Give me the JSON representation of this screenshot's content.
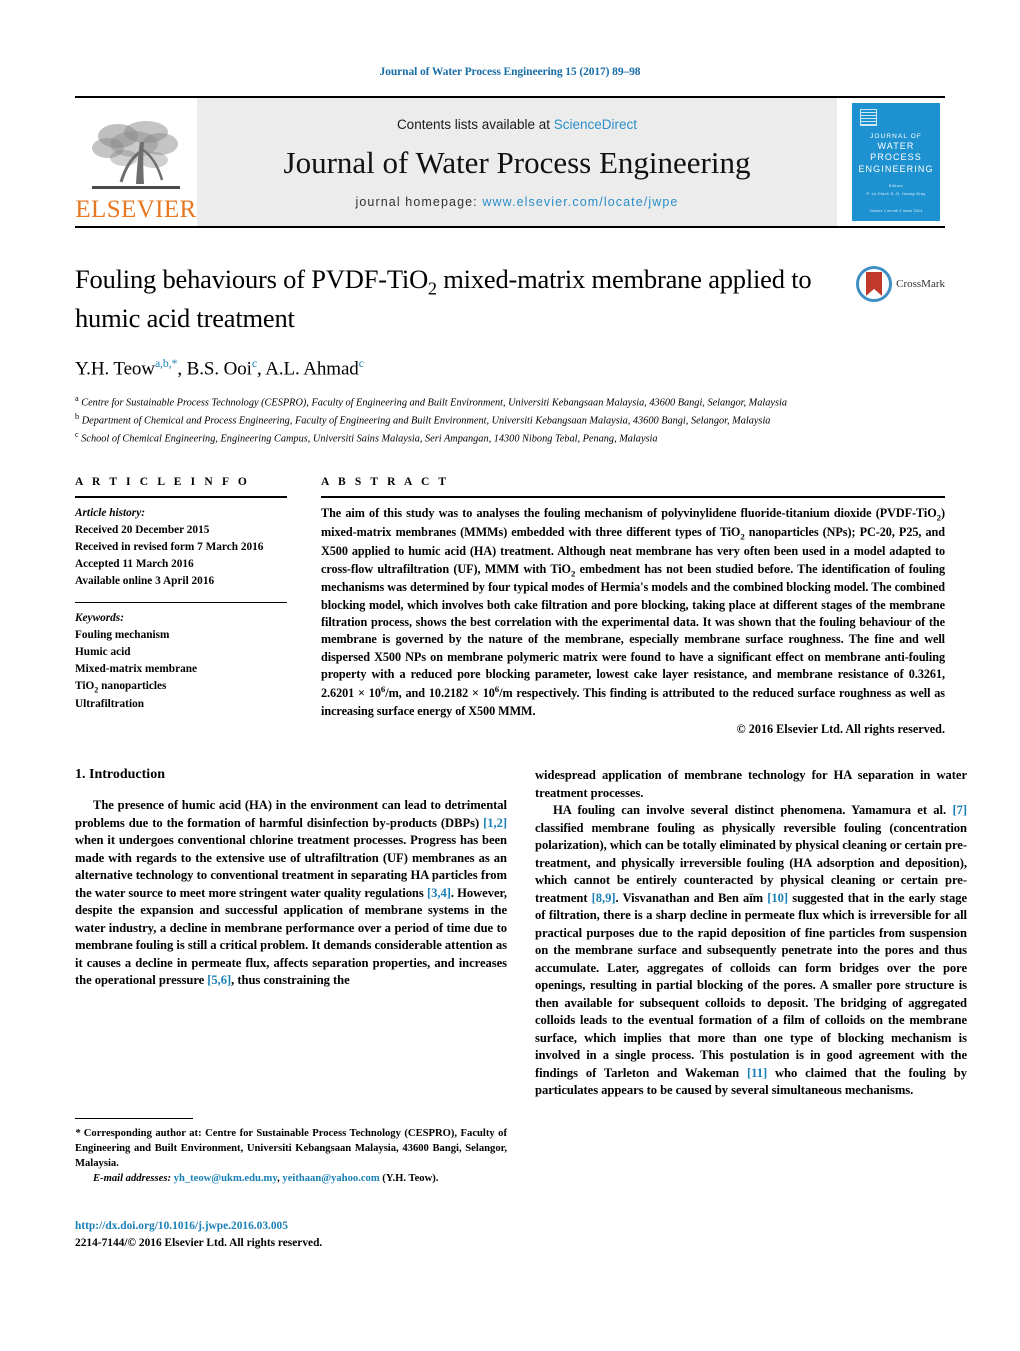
{
  "running_head": "Journal of Water Process Engineering 15 (2017) 89–98",
  "masthead": {
    "publisher_wordmark": "ELSEVIER",
    "contents_prefix": "Contents lists available at ",
    "contents_link": "ScienceDirect",
    "journal_title": "Journal of Water Process Engineering",
    "homepage_prefix": "journal homepage: ",
    "homepage_url": "www.elsevier.com/locate/jwpe",
    "cover": {
      "line1": "JOURNAL OF",
      "line2": "WATER PROCESS",
      "line3": "ENGINEERING",
      "sub1": "Editors",
      "sub2": "P. Le-Clech    S.-D. Huang Gray",
      "bottom": "Volume 1   month 2 issue 2014"
    },
    "accent_link_color": "#2b8fc9"
  },
  "article": {
    "title_part1": "Fouling behaviours of PVDF-TiO",
    "title_sub": "2",
    "title_part2": " mixed-matrix membrane applied to humic acid treatment",
    "crossmark_label": "CrossMark",
    "authors": [
      {
        "name": "Y.H. Teow",
        "sup": "a,b,*"
      },
      {
        "name": "B.S. Ooi",
        "sup": "c"
      },
      {
        "name": "A.L. Ahmad",
        "sup": "c"
      }
    ],
    "affiliations": [
      {
        "mark": "a",
        "text": "Centre for Sustainable Process Technology (CESPRO), Faculty of Engineering and Built Environment, Universiti Kebangsaan Malaysia, 43600 Bangi, Selangor, Malaysia"
      },
      {
        "mark": "b",
        "text": "Department of Chemical and Process Engineering, Faculty of Engineering and Built Environment, Universiti Kebangsaan Malaysia, 43600 Bangi, Selangor, Malaysia"
      },
      {
        "mark": "c",
        "text": "School of Chemical Engineering, Engineering Campus, Universiti Sains Malaysia, Seri Ampangan, 14300 Nibong Tebal, Penang, Malaysia"
      }
    ]
  },
  "article_info": {
    "heading": "A R T I C L E    I N F O",
    "history_label": "Article history:",
    "history": [
      "Received 20 December 2015",
      "Received in revised form 7 March 2016",
      "Accepted 11 March 2016",
      "Available online 3 April 2016"
    ],
    "keywords_label": "Keywords:",
    "keywords": [
      "Fouling mechanism",
      "Humic acid",
      "Mixed-matrix membrane",
      "TiO2 nanoparticles",
      "Ultrafiltration"
    ]
  },
  "abstract": {
    "heading": "A B S T R A C T",
    "text_1": "The aim of this study was to analyses the fouling mechanism of polyvinylidene fluoride-titanium dioxide (PVDF-TiO",
    "text_2": ") mixed-matrix membranes (MMMs) embedded with three different types of TiO",
    "text_3": " nanoparticles (NPs); PC-20, P25, and X500 applied to humic acid (HA) treatment. Although neat membrane has very often been used in a model adapted to cross-flow ultrafiltration (UF), MMM with TiO",
    "text_4": " embedment has not been studied before. The identification of fouling mechanisms was determined by four typical modes of Hermia's models and the combined blocking model. The combined blocking model, which involves both cake filtration and pore blocking, taking place at different stages of the membrane filtration process, shows the best correlation with the experimental data. It was shown that the fouling behaviour of the membrane is governed by the nature of the membrane, especially membrane surface roughness. The fine and well dispersed X500 NPs on membrane polymeric matrix were found to have a significant effect on membrane anti-fouling property with a reduced pore blocking parameter, lowest cake layer resistance, and membrane resistance of 0.3261, 2.6201 × 10",
    "text_5": "/m, and 10.2182 × 10",
    "text_6": "/m respectively. This finding is attributed to the reduced surface roughness as well as increasing surface energy of X500 MMM.",
    "exp": "6",
    "copyright": "© 2016 Elsevier Ltd. All rights reserved."
  },
  "introduction": {
    "section_title": "1.  Introduction",
    "left": {
      "p1_a": "The presence of humic acid (HA) in the environment can lead to detrimental problems due to the formation of harmful disinfection by-products (DBPs) ",
      "p1_ref1": "[1,2]",
      "p1_b": " when it undergoes conventional chlorine treatment processes. Progress has been made with regards to the extensive use of ultrafiltration (UF) membranes as an alternative technology to conventional treatment in separating HA particles from the water source to meet more stringent water quality regulations ",
      "p1_ref2": "[3,4]",
      "p1_c": ". However, despite the expansion and successful application of membrane systems in the water industry, a decline in membrane performance over a period of time due to membrane fouling is still a critical problem. It demands considerable attention as it causes a decline in permeate flux, affects separation properties, and increases the operational pressure ",
      "p1_ref3": "[5,6]",
      "p1_d": ", thus constraining the"
    },
    "right": {
      "p1_cont": "widespread application of membrane technology for HA separation in water treatment processes.",
      "p2_a": "HA fouling can involve several distinct phenomena. Yamamura et al. ",
      "p2_ref1": "[7]",
      "p2_b": " classified membrane fouling as physically reversible fouling (concentration polarization), which can be totally eliminated by physical cleaning or certain pre-treatment, and physically irreversible fouling (HA adsorption and deposition), which cannot be entirely counteracted by physical cleaning or certain pre-treatment ",
      "p2_ref2": "[8,9]",
      "p2_c": ". Visvanathan and Ben aïm ",
      "p2_ref3": "[10]",
      "p2_d": " suggested that in the early stage of filtration, there is a sharp decline in permeate flux which is irreversible for all practical purposes due to the rapid deposition of fine particles from suspension on the membrane surface and subsequently penetrate into the pores and thus accumulate. Later, aggregates of colloids can form bridges over the pore openings, resulting in partial blocking of the pores. A smaller pore structure is then available for subsequent colloids to deposit. The bridging of aggregated colloids leads to the eventual formation of a film of colloids on the membrane surface, which implies that more than one type of blocking mechanism is involved in a single process. This postulation is in good agreement with the findings of Tarleton and Wakeman ",
      "p2_ref4": "[11]",
      "p2_e": " who claimed that the fouling by particulates appears to be caused by several simultaneous mechanisms."
    }
  },
  "footnote": {
    "star": "*",
    "text": " Corresponding author at: Centre for Sustainable Process Technology (CESPRO), Faculty of Engineering and Built Environment, Universiti Kebangsaan Malaysia, 43600 Bangi, Selangor, Malaysia.",
    "email_label": "E-mail addresses:",
    "email1": "yh_teow@ukm.edu.my",
    "email2": "yeithaan@yahoo.com",
    "email_suffix": " (Y.H. Teow)."
  },
  "doi_block": {
    "doi": "http://dx.doi.org/10.1016/j.jwpe.2016.03.005",
    "issn_line": "2214-7144/© 2016 Elsevier Ltd. All rights reserved."
  }
}
